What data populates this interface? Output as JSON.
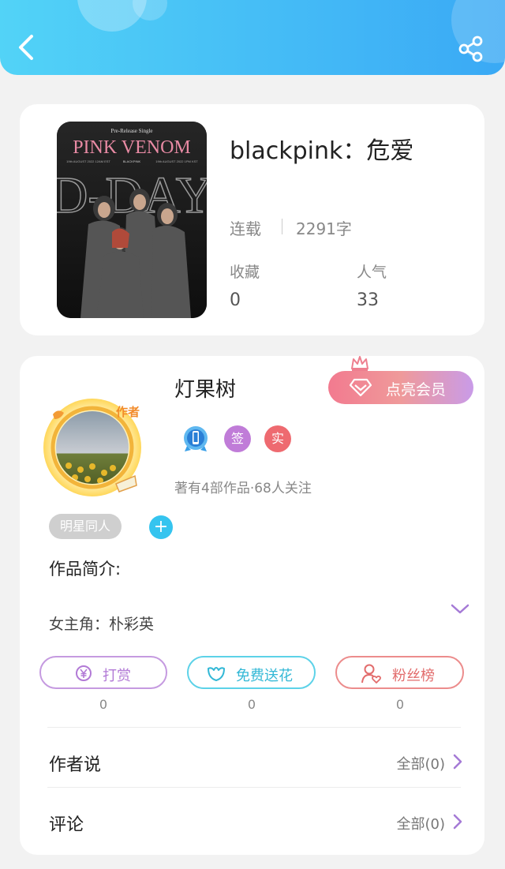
{
  "header": {
    "back_icon": "back-arrow-icon",
    "share_icon": "share-icon"
  },
  "book": {
    "title": "blackpink：危爱",
    "status": "连载",
    "word_count": "2291字",
    "favorites_label": "收藏",
    "favorites_value": "0",
    "popularity_label": "人气",
    "popularity_value": "33",
    "cover": {
      "subtitle": "Pre-Release Single",
      "line1": "PINK VENOM",
      "line2": "D-DAY",
      "small_left": "19th AUGUST 2022 12AM EST",
      "small_right": "19th AUGUST 2022 1PM KST",
      "small_brand": "BLACKPINK"
    }
  },
  "author": {
    "name": "灯果树",
    "avatar_label": "作者",
    "vip_button": "点亮会员",
    "badge_sign": "签",
    "badge_real": "实",
    "meta": "著有4部作品·68人关注",
    "tag": "明星同人",
    "tag_add": "+"
  },
  "intro": {
    "title": "作品简介:",
    "text": "女主角：朴彩英"
  },
  "actions": {
    "reward_label": "打赏",
    "reward_count": "0",
    "flower_label": "免费送花",
    "flower_count": "0",
    "fans_label": "粉丝榜",
    "fans_count": "0"
  },
  "sections": {
    "author_says": "作者说",
    "author_says_link": "全部(0)",
    "comments": "评论",
    "comments_link": "全部(0)"
  },
  "colors": {
    "header_start": "#52d3f7",
    "header_end": "#3aa9f5",
    "purple": "#b27ad6",
    "cyan": "#33b8d6",
    "red": "#e26c6c"
  }
}
